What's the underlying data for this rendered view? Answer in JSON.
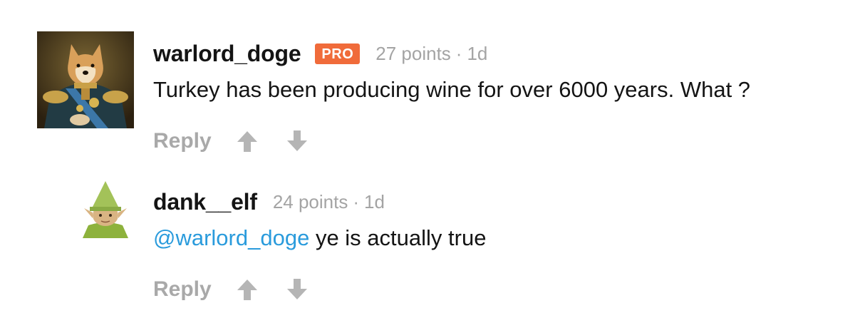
{
  "comments": [
    {
      "username": "warlord_doge",
      "badge": "PRO",
      "points": "27 points",
      "separator": "·",
      "time": "1d",
      "mention": "",
      "text": "Turkey has been producing wine for over 6000 years. What ?",
      "reply_label": "Reply",
      "avatar_icon": "doge-general-portrait-avatar"
    },
    {
      "username": "dank__elf",
      "points": "24 points",
      "separator": "·",
      "time": "1d",
      "mention": "@warlord_doge",
      "text": " ye is actually true",
      "reply_label": "Reply",
      "avatar_icon": "elf-gnome-avatar"
    }
  ],
  "colors": {
    "badge": "#f06b3a",
    "mention": "#2a9bdc",
    "meta": "#a4a4a4",
    "action": "#a9a9a9"
  },
  "icons": {
    "upvote": "arrow-up-icon",
    "downvote": "arrow-down-icon"
  }
}
